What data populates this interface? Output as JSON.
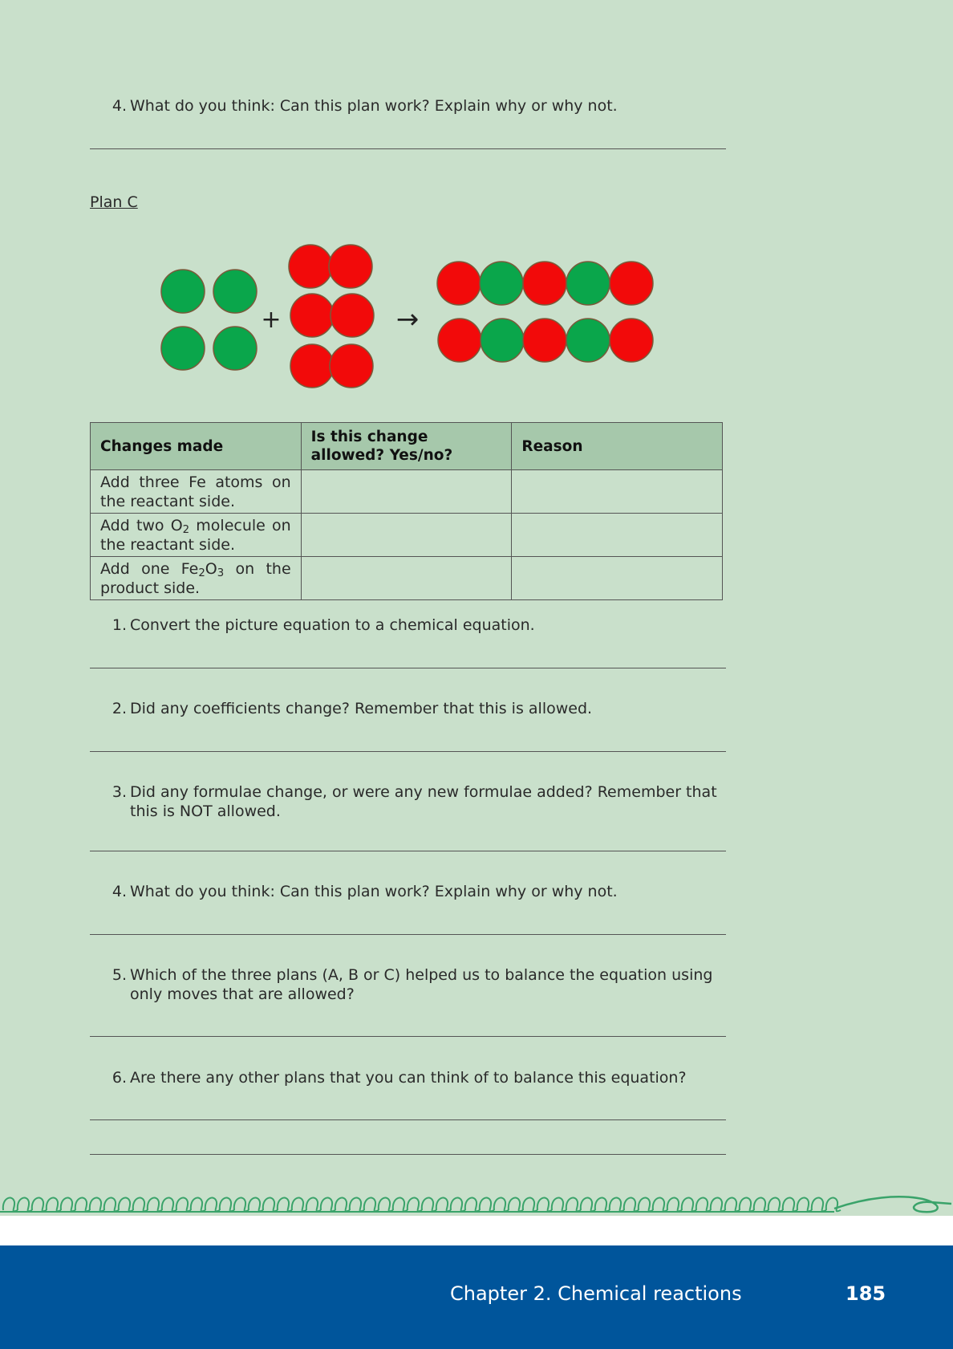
{
  "top_question": {
    "number": "4.",
    "text": "What do you think: Can this plan work? Explain why or why not."
  },
  "plan_label": "Plan C",
  "diagram": {
    "plus": "+",
    "arrow": "→",
    "colors": {
      "iron": "#0aa64b",
      "oxygen": "#f20a0a",
      "outline": "#7a5a3a"
    }
  },
  "table": {
    "headers": [
      "Changes made",
      "Is this change allowed? Yes/no?",
      "Reason"
    ],
    "rows": [
      {
        "pre": "Add three Fe atoms on the reactant side.",
        "sub": "",
        "post": ""
      },
      {
        "pre": "Add two O",
        "sub": "2",
        "post": " molecule on the reactant side."
      },
      {
        "pre": "Add one Fe",
        "sub": "2",
        "mid": "O",
        "sub2": "3",
        "post": " on the product side."
      }
    ]
  },
  "questions": [
    {
      "number": "1.",
      "text": "Convert the picture equation to a chemical equation."
    },
    {
      "number": "2.",
      "text": "Did any coefficients change? Remember that this is allowed."
    },
    {
      "number": "3.",
      "text": "Did any formulae change, or were any new formulae added? Remember that this is NOT allowed."
    },
    {
      "number": "4.",
      "text": "What do you think: Can this plan work? Explain why or why not."
    },
    {
      "number": "5.",
      "text": "Which of the three plans (A, B or C) helped us to balance the equation using only moves that are allowed?"
    },
    {
      "number": "6.",
      "text": "Are there any other plans that you can think of to balance this equation?"
    }
  ],
  "footer": {
    "chapter": "Chapter 2.   Chemical reactions",
    "page": "185",
    "background": "#00559b"
  }
}
